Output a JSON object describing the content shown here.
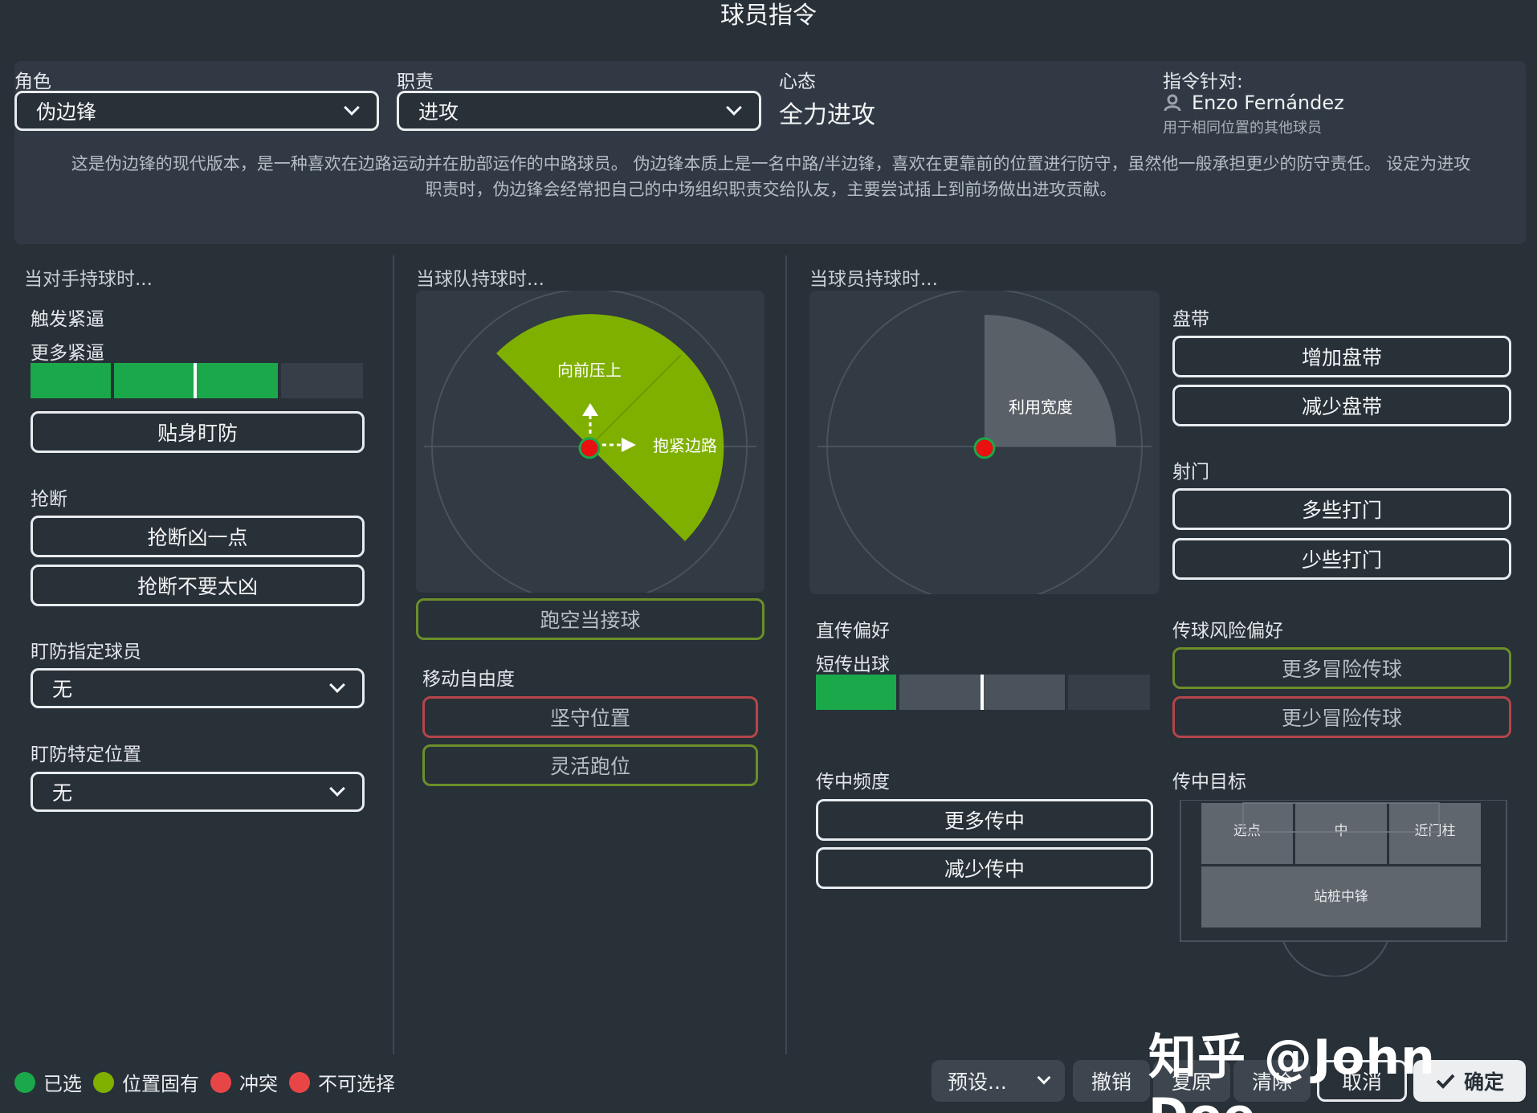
{
  "window": {
    "title": "球员指令"
  },
  "top": {
    "role_label": "角色",
    "role_value": "伪边锋",
    "duty_label": "职责",
    "duty_value": "进攻",
    "mentality_label": "心态",
    "mentality_value": "全力进攻",
    "target_label": "指令针对:",
    "target_player": "Enzo Fernández",
    "target_sub": "用于相同位置的其他球员",
    "description_line1": "这是伪边锋的现代版本，是一种喜欢在边路运动并在肋部运作的中路球员。 伪边锋本质上是一名中路/半边锋，喜欢在更靠前的位置进行防守，虽然他一般承担更少的防守责任。 设定为进攻",
    "description_line2": "职责时，伪边锋会经常把自己的中场组织职责交给队友，主要尝试插上到前场做出进攻贡献。"
  },
  "col1": {
    "heading": "当对手持球时...",
    "press_label": "触发紧逼",
    "press_value": "更多紧逼",
    "press_level": 0.67,
    "tight_marking": "贴身盯防",
    "tackle_label": "抢断",
    "tackle_harder": "抢断凶一点",
    "tackle_ease": "抢断不要太凶",
    "mark_player_label": "盯防指定球员",
    "mark_player_value": "无",
    "mark_position_label": "盯防特定位置",
    "mark_position_value": "无"
  },
  "col2": {
    "heading": "当球队持球时...",
    "pitch_forward": "向前压上",
    "pitch_wide": "抱紧边路",
    "get_further": "跑空当接球",
    "freedom_label": "移动自由度",
    "hold_position": "坚守位置",
    "roam": "灵活跑位"
  },
  "col3": {
    "heading": "当球员持球时...",
    "pitch_width": "利用宽度",
    "direct_label": "直传偏好",
    "direct_value": "短传出球",
    "direct_level": 0.25,
    "cross_freq_label": "传中频度",
    "cross_more": "更多传中",
    "cross_less": "减少传中"
  },
  "col4": {
    "dribble_label": "盘带",
    "dribble_more": "增加盘带",
    "dribble_less": "减少盘带",
    "shoot_label": "射门",
    "shoot_more": "多些打门",
    "shoot_less": "少些打门",
    "risk_label": "传球风险偏好",
    "risk_more": "更多冒险传球",
    "risk_less": "更少冒险传球",
    "cross_target_label": "传中目标",
    "target_far": "远点",
    "target_centre": "中",
    "target_near": "近门柱",
    "target_striker": "站桩中锋"
  },
  "legend": {
    "selected": "已选",
    "inherent": "位置固有",
    "conflict": "冲突",
    "unavailable": "不可选择"
  },
  "footer": {
    "presets": "预设...",
    "undo": "撤销",
    "reset": "复原",
    "clear": "清除",
    "cancel": "取消",
    "confirm": "确定"
  },
  "watermark": "知乎 @John Doe",
  "colors": {
    "selected": "#1aa84a",
    "inherent": "#7fb000",
    "conflict": "#e84646",
    "unavailable": "#e84646",
    "background": "#283038"
  }
}
